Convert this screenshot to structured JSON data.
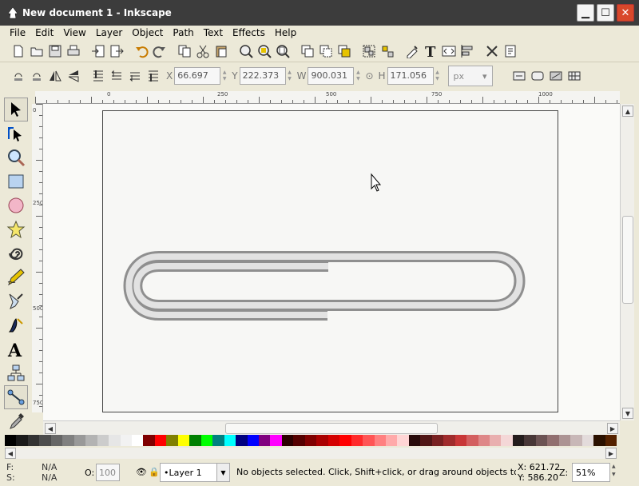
{
  "window": {
    "title": "New document 1 - Inkscape",
    "buttons": {
      "minimize": "▁",
      "maximize": "☐",
      "close": "✕"
    }
  },
  "menu": [
    "File",
    "Edit",
    "View",
    "Layer",
    "Object",
    "Path",
    "Text",
    "Effects",
    "Help"
  ],
  "command_toolbar": [
    "new-icon",
    "open-icon",
    "save-icon",
    "print-icon",
    "import-icon",
    "export-icon",
    "undo-icon",
    "redo-icon",
    "copy-icon",
    "cut-icon",
    "paste-icon",
    "zoom-selection-icon",
    "zoom-drawing-icon",
    "zoom-page-icon",
    "duplicate-icon",
    "clone-icon",
    "unlink-clone-icon",
    "group-icon",
    "ungroup-icon",
    "fill-stroke-icon",
    "text-font-icon",
    "xml-editor-icon",
    "align-icon",
    "preferences-icon",
    "document-properties-icon"
  ],
  "controls": {
    "x_label": "X",
    "x_value": "66.697",
    "y_label": "Y",
    "y_value": "222.373",
    "w_label": "W",
    "w_value": "900.031",
    "h_label": "H",
    "h_value": "171.056",
    "unit": "px"
  },
  "ruler": {
    "labels": [
      "0",
      "250",
      "500",
      "750",
      "1000"
    ],
    "vlabels": [
      "0",
      "250",
      "500",
      "750"
    ]
  },
  "tools": [
    "selector-icon",
    "node-icon",
    "zoom-icon",
    "rectangle-icon",
    "ellipse-icon",
    "star-icon",
    "spiral-icon",
    "pencil-icon",
    "pen-icon",
    "calligraphy-icon",
    "text-icon",
    "connector-icon",
    "tweak-icon",
    "dropper-icon"
  ],
  "palette": [
    "#000000",
    "#1a1a1a",
    "#333333",
    "#4d4d4d",
    "#666666",
    "#808080",
    "#999999",
    "#b3b3b3",
    "#cccccc",
    "#e6e6e6",
    "#f2f2f2",
    "#ffffff",
    "#800000",
    "#ff0000",
    "#808000",
    "#ffff00",
    "#008000",
    "#00ff00",
    "#008080",
    "#00ffff",
    "#000080",
    "#0000ff",
    "#800080",
    "#ff00ff",
    "#2b0000",
    "#550000",
    "#800000",
    "#aa0000",
    "#d40000",
    "#ff0000",
    "#ff2a2a",
    "#ff5555",
    "#ff8080",
    "#ffaaaa",
    "#ffd5d5",
    "#280b0b",
    "#501616",
    "#782121",
    "#a02c2c",
    "#c83737",
    "#d35f5f",
    "#de8787",
    "#e9afaf",
    "#f4d7d7",
    "#241c1c",
    "#483737",
    "#6c5353",
    "#916f6f",
    "#ac9393",
    "#c8b7b7",
    "#e3dbdb",
    "#2b1100",
    "#552200"
  ],
  "status": {
    "fill_label": "F:",
    "fill_value": "N/A",
    "stroke_label": "S:",
    "stroke_value": "N/A",
    "opacity_label": "O:",
    "opacity_value": "100",
    "layer": "•Layer 1",
    "message": "No objects selected. Click, Shift+click, or drag around objects to sele",
    "x_coord": "X: 621.72",
    "y_coord": "Y: 586.20",
    "zoom_label": "Z:",
    "zoom_value": "51%"
  },
  "colors": {
    "paperclip_stroke": "#9a9a9a",
    "paperclip_fill": "#d9d9d9",
    "page_border": "#444444"
  }
}
